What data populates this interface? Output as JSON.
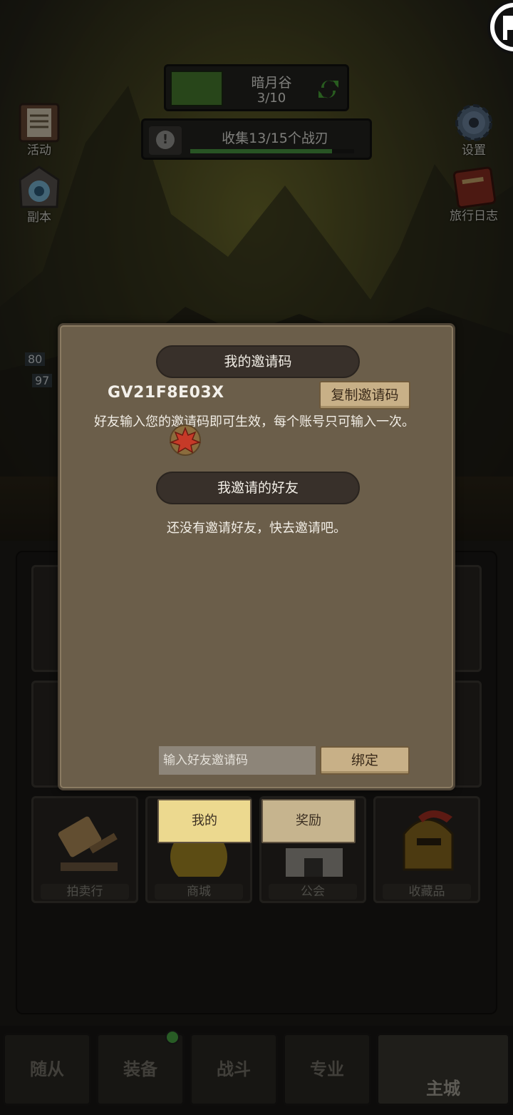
{
  "stage": {
    "name": "暗月谷",
    "progress": "3/10"
  },
  "quest": {
    "text": "收集13/15个战刃",
    "progress": 0.8667
  },
  "side_left": [
    {
      "label": "活动",
      "icon": "scroll-board-icon"
    },
    {
      "label": "副本",
      "icon": "dungeon-portal-icon"
    }
  ],
  "side_right": [
    {
      "label": "设置",
      "icon": "gear-icon"
    },
    {
      "label": "旅行日志",
      "icon": "journal-book-icon"
    }
  ],
  "status_values": [
    "80",
    "97"
  ],
  "modal": {
    "my_code_title": "我的邀请码",
    "code": "GV21F8E03X",
    "copy_button": "复制邀请码",
    "description": "好友输入您的邀请码即可生效，每个账号只可输入一次。",
    "friends_title": "我邀请的好友",
    "empty_text": "还没有邀请好友，快去邀请吧。",
    "input_placeholder": "输入好友邀请码",
    "bind_button": "绑定"
  },
  "tabs": {
    "mine": "我的",
    "reward": "奖励"
  },
  "tiles": [
    "拍卖行",
    "商城",
    "公会",
    "收藏品"
  ],
  "nav": [
    "随从",
    "装备",
    "战斗",
    "专业",
    "主城"
  ],
  "colors": {
    "modal_bg": "#6b5e4a",
    "pill_bg": "#38302a",
    "wood": "#c8b087",
    "tab_active": "#ecd98f",
    "green": "#4a8030"
  }
}
